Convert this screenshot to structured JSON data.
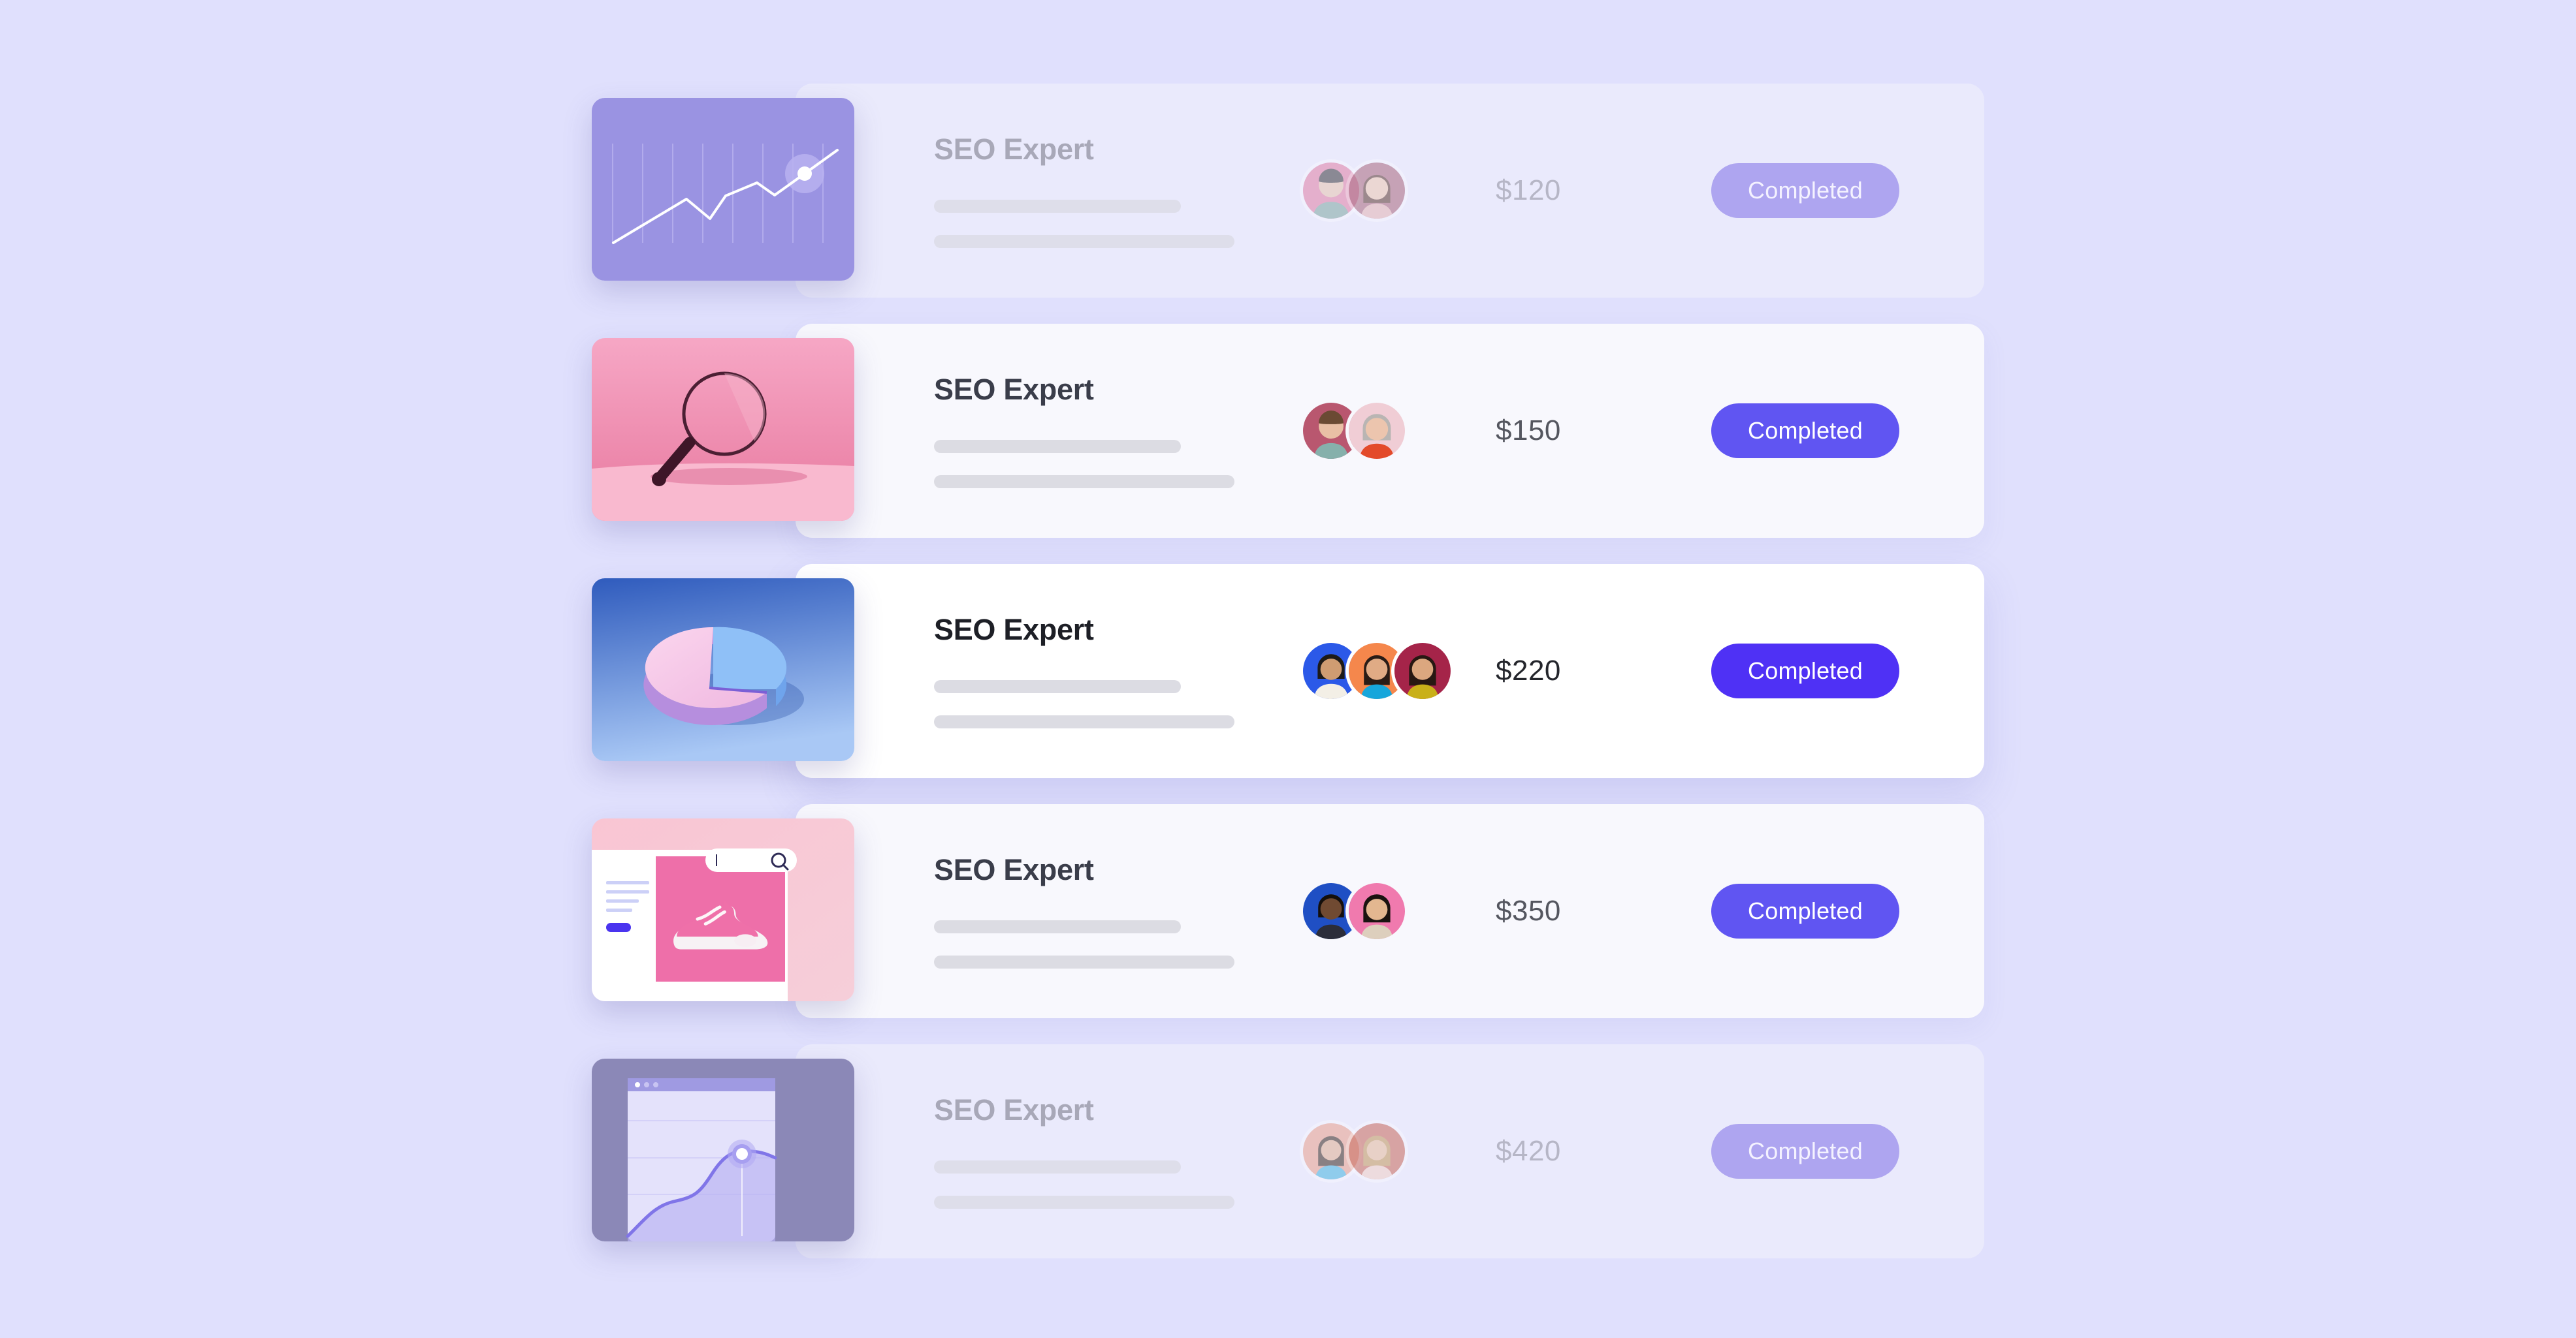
{
  "page": {
    "background_color": "#e0e0fd",
    "accent_color": "#4f31f5",
    "accent_muted_color": "#aea5f0"
  },
  "rows": [
    {
      "state": "dim",
      "thumbnail": "line-chart-thumbnail",
      "title": "SEO Expert",
      "price": "$120",
      "status": "Completed",
      "avatars": [
        "avatar-1",
        "avatar-2"
      ],
      "avatar_count": 2
    },
    {
      "state": "normal",
      "thumbnail": "magnifying-glass-thumbnail",
      "title": "SEO Expert",
      "price": "$150",
      "status": "Completed",
      "avatars": [
        "avatar-1",
        "avatar-2"
      ],
      "avatar_count": 2
    },
    {
      "state": "active",
      "thumbnail": "pie-chart-thumbnail",
      "title": "SEO Expert",
      "price": "$220",
      "status": "Completed",
      "avatars": [
        "avatar-1",
        "avatar-2",
        "avatar-3"
      ],
      "avatar_count": 3
    },
    {
      "state": "normal",
      "thumbnail": "ecommerce-sneaker-thumbnail",
      "title": "SEO Expert",
      "price": "$350",
      "status": "Completed",
      "avatars": [
        "avatar-1",
        "avatar-2"
      ],
      "avatar_count": 2
    },
    {
      "state": "dim",
      "thumbnail": "browser-area-chart-thumbnail",
      "title": "SEO Expert",
      "price": "$420",
      "status": "Completed",
      "avatars": [
        "avatar-1",
        "avatar-2"
      ],
      "avatar_count": 2
    }
  ]
}
